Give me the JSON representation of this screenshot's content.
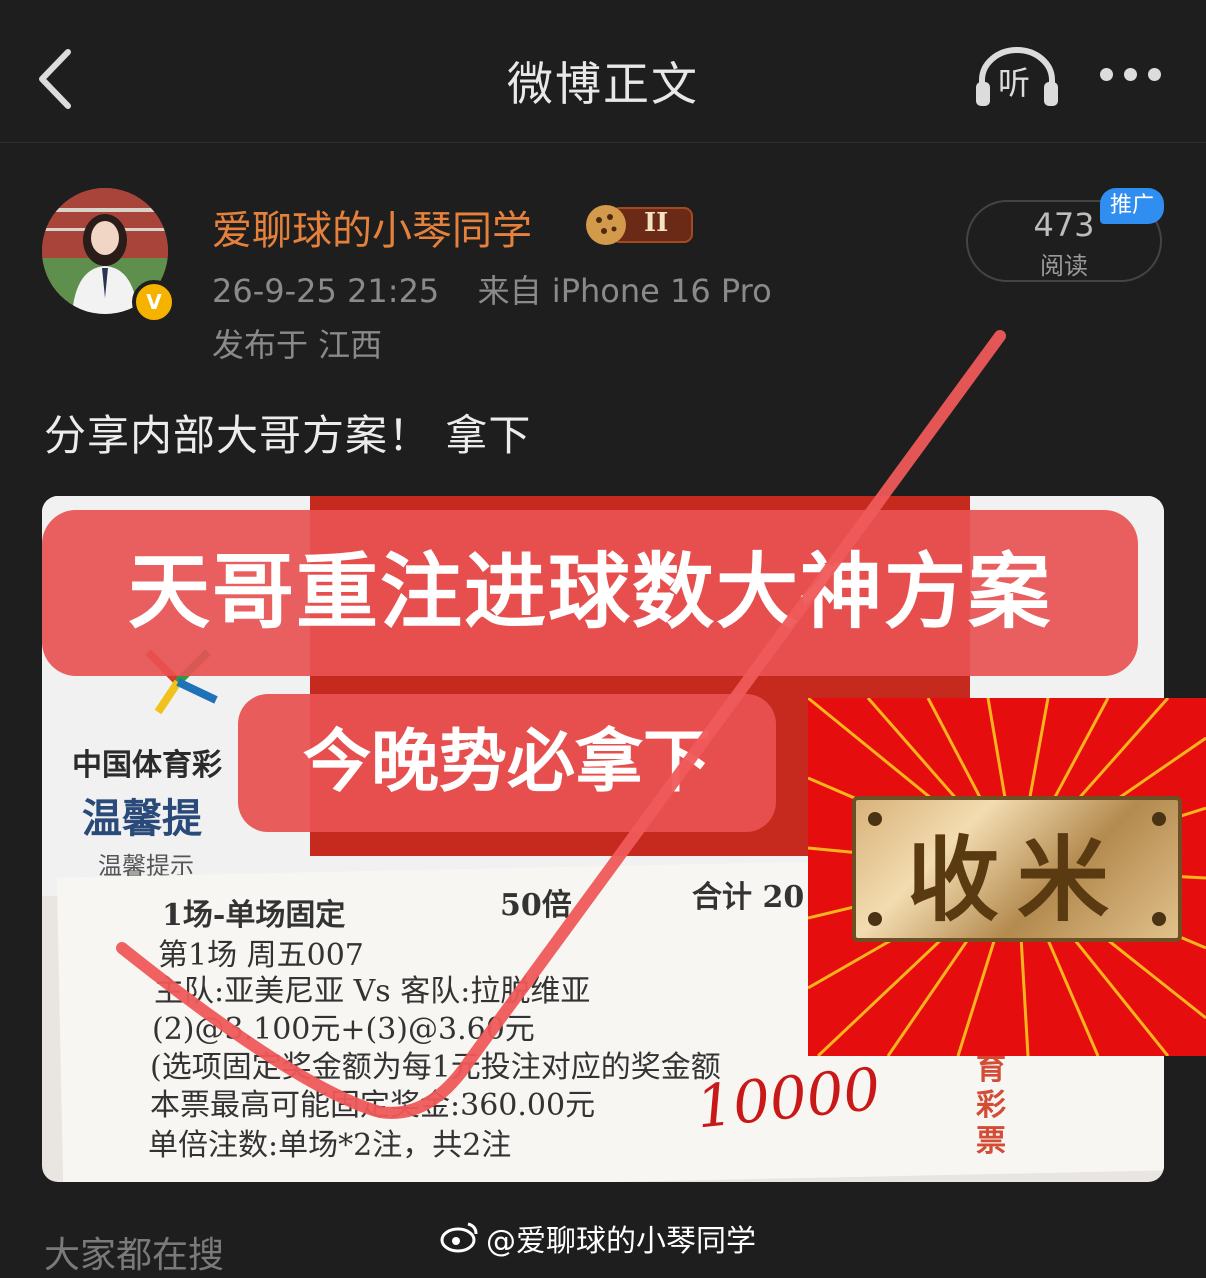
{
  "header": {
    "title": "微博正文",
    "listen_label": "听"
  },
  "author": {
    "name": "爱聊球的小琴同学",
    "badge_level": "II",
    "verified_mark": "V",
    "timestamp": "26-9-25 21:25",
    "source": "来自 iPhone 16 Pro",
    "location": "发布于 江西"
  },
  "stats": {
    "reads_count": "473",
    "reads_label": "阅读",
    "promo_label": "推广"
  },
  "post": {
    "text": "分享内部大哥方案！ 拿下"
  },
  "image": {
    "headline": "天哥重注进球数大神方案",
    "subline": "今晚势必拿下",
    "ticket": {
      "brand_line1": "中国体育彩",
      "brand_line2": "温馨提",
      "brand_line3": "温馨提示",
      "header_left": "1场-单场固定",
      "multiplier": "50倍",
      "total": "合计 20",
      "match_no": "第1场    周五007",
      "teams": "主队:亚美尼亚 Vs 客队:拉脱维亚",
      "odds": "(2)@3.100元+(3)@3.60元",
      "note": "(选项固定奖金额为每1元投注对应的奖金额",
      "max_prize": "本票最高可能固定奖金:360.00元",
      "bets": "单倍注数:单场*2注，共2注",
      "handwritten_amount": "10000",
      "side_text": "育彩票"
    },
    "sticker_text": "收米"
  },
  "footer": {
    "search_label": "大家都在搜",
    "watermark": "@爱聊球的小琴同学"
  },
  "colors": {
    "background": "#1e1e1e",
    "author_name": "#e6813c",
    "promo": "#2f8ef0",
    "headline_bg": "#e85252",
    "checkmark": "#ef5a5a"
  }
}
